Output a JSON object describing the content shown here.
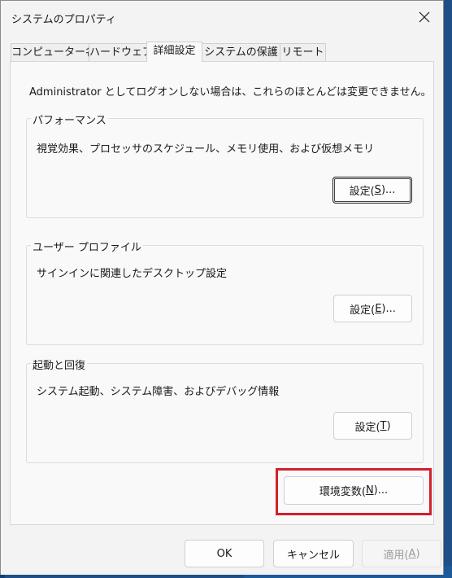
{
  "window": {
    "title": "システムのプロパティ"
  },
  "tabs": [
    {
      "label": "コンピューター名"
    },
    {
      "label": "ハードウェア"
    },
    {
      "label": "詳細設定"
    },
    {
      "label": "システムの保護"
    },
    {
      "label": "リモート"
    }
  ],
  "active_tab": "詳細設定",
  "intro": "Administrator としてログオンしない場合は、これらのほとんどは変更できません。",
  "groups": {
    "performance": {
      "title": "パフォーマンス",
      "desc": "視覚効果、プロセッサのスケジュール、メモリ使用、および仮想メモリ",
      "btn_text": "設定(",
      "btn_key": "S",
      "btn_tail": ")..."
    },
    "user_profiles": {
      "title": "ユーザー プロファイル",
      "desc": "サインインに関連したデスクトップ設定",
      "btn_text": "設定(",
      "btn_key": "E",
      "btn_tail": ")..."
    },
    "startup": {
      "title": "起動と回復",
      "desc": "システム起動、システム障害、およびデバッグ情報",
      "btn_text": "設定(",
      "btn_key": "T",
      "btn_tail": ")"
    }
  },
  "env_button": {
    "text": "環境変数(",
    "key": "N",
    "tail": ")..."
  },
  "footer": {
    "ok": "OK",
    "cancel": "キャンセル",
    "apply_text": "適用(",
    "apply_key": "A",
    "apply_tail": ")"
  },
  "colors": {
    "highlight": "#d1202b",
    "dialog_bg": "#f3f3f3",
    "panel_bg": "#f9f9f9"
  }
}
